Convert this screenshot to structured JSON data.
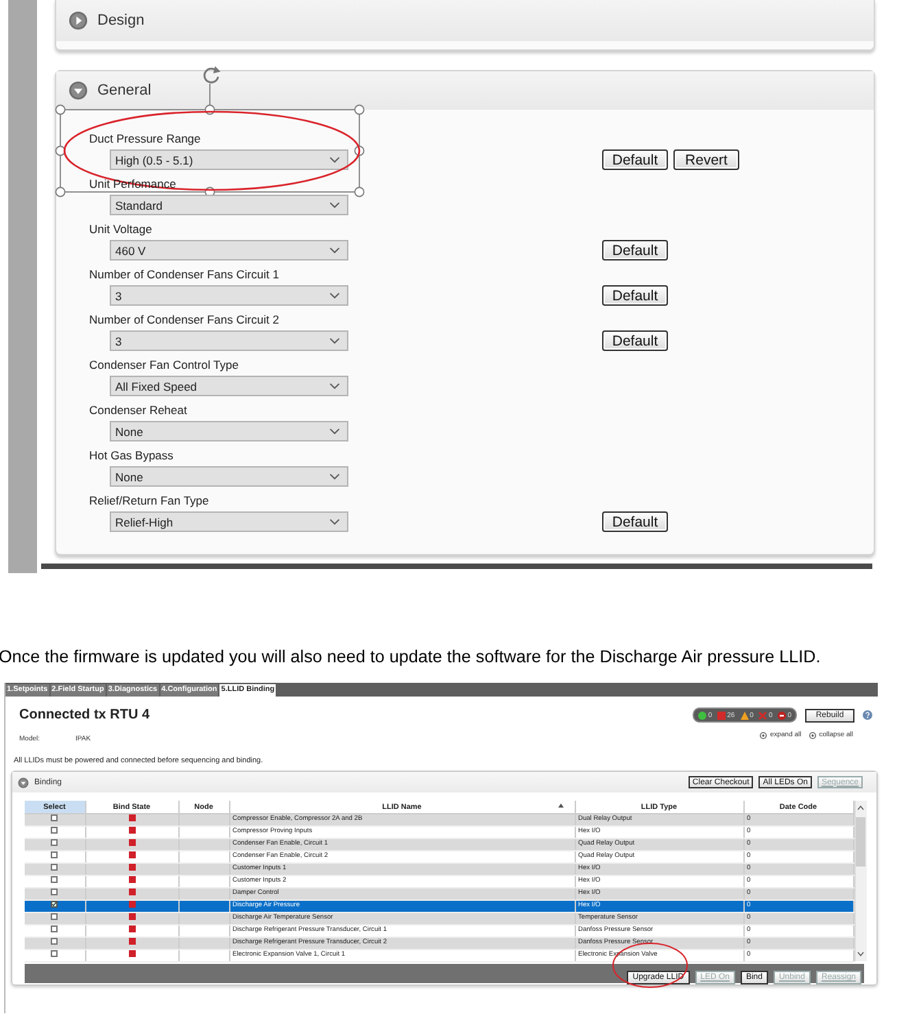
{
  "settings_screenshot": {
    "panels": [
      {
        "title": "Design",
        "expanded": false
      },
      {
        "title": "General",
        "expanded": true
      }
    ],
    "fields": [
      {
        "label": "Duct Pressure Range",
        "value": "High (0.5 - 5.1)",
        "buttons": [
          "Default",
          "Revert"
        ],
        "circled": true
      },
      {
        "label": "Unit Perfomance",
        "value": "Standard",
        "circled": false
      },
      {
        "label": "Unit Voltage",
        "value": "460 V",
        "buttons": [
          "Default"
        ],
        "circled": false
      },
      {
        "label": "Number of Condenser Fans Circuit 1",
        "value": "3",
        "buttons": [
          "Default"
        ],
        "circled": false
      },
      {
        "label": "Number of Condenser Fans Circuit 2",
        "value": "3",
        "buttons": [
          "Default"
        ],
        "circled": false
      },
      {
        "label": "Condenser Fan Control Type",
        "value": "All Fixed Speed",
        "circled": false
      },
      {
        "label": "Condenser Reheat",
        "value": "None",
        "circled": false
      },
      {
        "label": "Hot Gas Bypass",
        "value": "None",
        "circled": false
      },
      {
        "label": "Relief/Return Fan Type",
        "value": "Relief-High",
        "buttons": [
          "Default"
        ],
        "circled": false
      }
    ]
  },
  "caption": "Once the firmware is updated you will also need to update the software for the Discharge Air pressure LLID.",
  "llid_screenshot": {
    "tabs": [
      {
        "label": "1.Setpoints",
        "selected": false
      },
      {
        "label": "2.Field Startup",
        "selected": false
      },
      {
        "label": "3.Diagnostics",
        "selected": false
      },
      {
        "label": "4.Configuration",
        "selected": false
      },
      {
        "label": "5.LLID Binding",
        "selected": true
      }
    ],
    "title": "Connected tx RTU  4",
    "model_label": "Model:",
    "model_value": "IPAK",
    "status_counts": [
      {
        "kind": "ok",
        "count": "0"
      },
      {
        "kind": "fault",
        "count": "26"
      },
      {
        "kind": "warning",
        "count": "0"
      },
      {
        "kind": "error",
        "count": "0"
      },
      {
        "kind": "blocked",
        "count": "0"
      }
    ],
    "rebuild_button": "Rebuild",
    "expand_all": "expand all",
    "collapse_all": "collapse all",
    "notice": "All LLIDs must be powered and connected before sequencing and binding.",
    "binding_panel": {
      "title": "Binding",
      "expanded": true,
      "header_buttons": [
        {
          "label": "Clear Checkout",
          "disabled": false
        },
        {
          "label": "All LEDs On",
          "disabled": false
        },
        {
          "label": "Sequence",
          "disabled": true
        }
      ],
      "columns": [
        "Select",
        "Bind State",
        "Node",
        "LLID Name",
        "LLID Type",
        "Date Code"
      ],
      "rows": [
        {
          "checked": false,
          "selected": false,
          "bound": false,
          "name": "Compressor Enable, Compressor 2A and 2B",
          "type": "Dual Relay Output",
          "date_code": "0"
        },
        {
          "checked": false,
          "selected": false,
          "bound": false,
          "name": "Compressor Proving Inputs",
          "type": "Hex I/O",
          "date_code": "0"
        },
        {
          "checked": false,
          "selected": false,
          "bound": false,
          "name": "Condenser Fan Enable, Circuit 1",
          "type": "Quad Relay Output",
          "date_code": "0"
        },
        {
          "checked": false,
          "selected": false,
          "bound": false,
          "name": "Condenser Fan Enable, Circuit 2",
          "type": "Quad Relay Output",
          "date_code": "0"
        },
        {
          "checked": false,
          "selected": false,
          "bound": false,
          "name": "Customer Inputs 1",
          "type": "Hex I/O",
          "date_code": "0"
        },
        {
          "checked": false,
          "selected": false,
          "bound": false,
          "name": "Customer Inputs 2",
          "type": "Hex I/O",
          "date_code": "0"
        },
        {
          "checked": false,
          "selected": false,
          "bound": false,
          "name": "Damper Control",
          "type": "Hex I/O",
          "date_code": "0"
        },
        {
          "checked": true,
          "selected": true,
          "bound": false,
          "name": "Discharge Air Pressure",
          "type": "Hex I/O",
          "date_code": "0"
        },
        {
          "checked": false,
          "selected": false,
          "bound": false,
          "name": "Discharge Air Temperature Sensor",
          "type": "Temperature Sensor",
          "date_code": "0"
        },
        {
          "checked": false,
          "selected": false,
          "bound": false,
          "name": "Discharge Refrigerant Pressure Transducer, Circuit 1",
          "type": "Danfoss Pressure Sensor",
          "date_code": "0"
        },
        {
          "checked": false,
          "selected": false,
          "bound": false,
          "name": "Discharge Refrigerant Pressure Transducer, Circuit 2",
          "type": "Danfoss Pressure Sensor",
          "date_code": "0"
        },
        {
          "checked": false,
          "selected": false,
          "bound": false,
          "name": "Electronic Expansion Valve 1, Circuit 1",
          "type": "Electronic Expansion Valve",
          "date_code": "0"
        }
      ],
      "footer_buttons": [
        {
          "label": "Upgrade LLID",
          "disabled": false,
          "circled": true
        },
        {
          "label": "LED On",
          "disabled": true,
          "circled": false
        },
        {
          "label": "Bind",
          "disabled": false,
          "circled": false
        },
        {
          "label": "Unbind",
          "disabled": true,
          "circled": false
        },
        {
          "label": "Reassign",
          "disabled": true,
          "circled": false
        }
      ]
    }
  }
}
